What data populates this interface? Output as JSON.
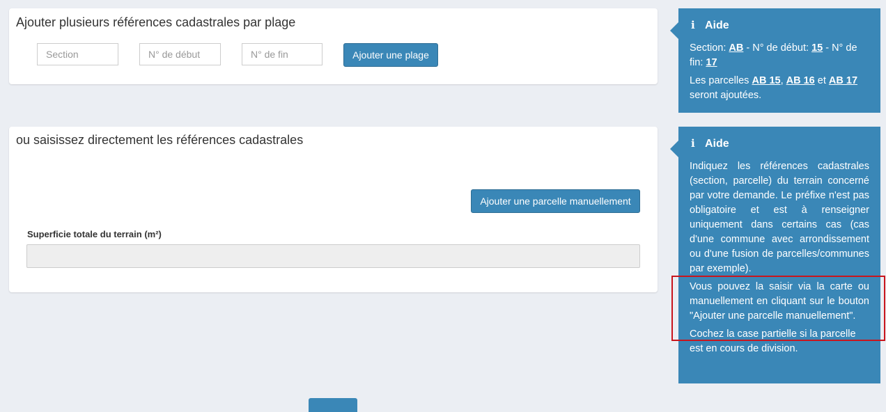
{
  "range_panel": {
    "title": "Ajouter plusieurs références cadastrales par plage",
    "section_placeholder": "Section",
    "start_placeholder": "N° de début",
    "end_placeholder": "N° de fin",
    "add_range_button": "Ajouter une plage"
  },
  "direct_panel": {
    "title": "ou saisissez directement les références cadastrales",
    "add_parcel_button": "Ajouter une parcelle manuellement",
    "total_area_label": "Superficie totale du terrain (m²)",
    "total_area_value": ""
  },
  "help1": {
    "title": "Aide",
    "icon": "info-icon",
    "section_prefix": "Section: ",
    "section_value": "AB",
    "start_prefix": " - N° de début: ",
    "start_value": "15",
    "end_prefix": " - N° de fin: ",
    "end_value": "17",
    "parcels_prefix": "Les parcelles ",
    "parcel_a": "AB 15",
    "sep_comma": ", ",
    "parcel_b": "AB 16",
    "sep_and": " et ",
    "parcel_c": "AB 17",
    "parcels_suffix": " seront ajoutées."
  },
  "help2": {
    "title": "Aide",
    "icon": "info-icon",
    "paragraph1": "Indiquez les références cadastrales (section, parcelle) du terrain concerné par votre demande. Le préfixe n'est pas obligatoire et est à renseigner uniquement dans certains cas (cas d'une commune avec arrondissement ou d'une fusion de parcelles/communes par exemple).",
    "paragraph2": "Vous pouvez la saisir via la carte ou manuellement en cliquant sur le bouton \"Ajouter une parcelle manuellement\".",
    "paragraph3": "Cochez la case partielle si la parcelle est en cours de division."
  },
  "colors": {
    "primary": "#3a87b7",
    "background": "#ebeef3",
    "highlight": "#c9151d"
  }
}
